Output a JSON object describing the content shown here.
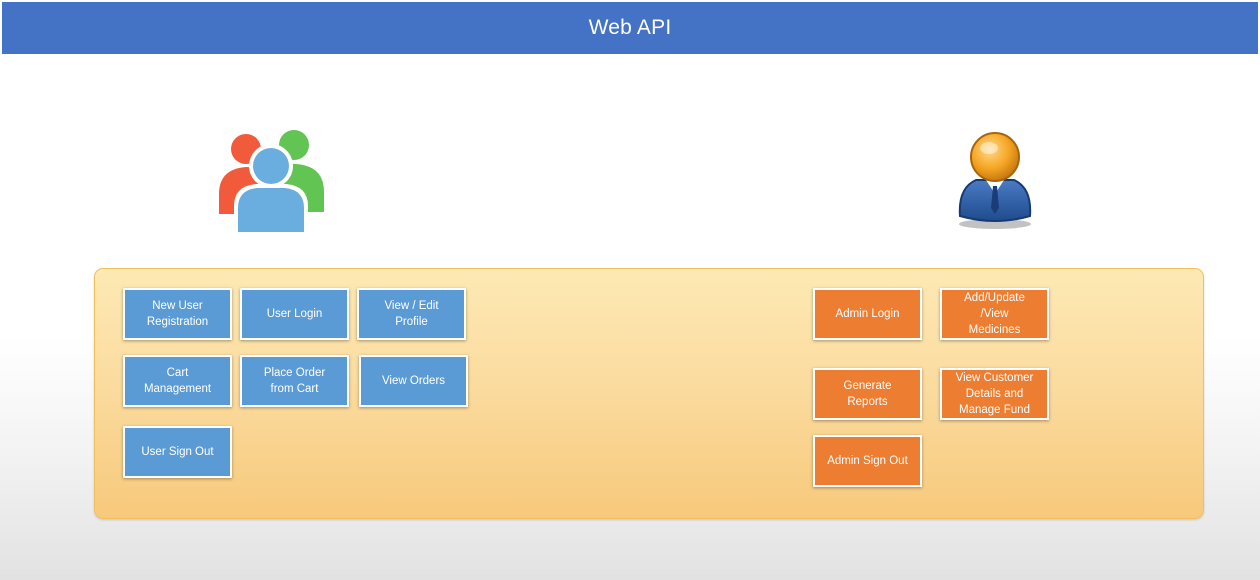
{
  "title": "Web API",
  "icons": {
    "users": "users-group-icon",
    "admin": "admin-user-icon"
  },
  "colors": {
    "header": "#4472c4",
    "user_box": "#5b9bd5",
    "admin_box": "#ed7d31",
    "panel": "#fbdca0"
  },
  "user_actions": {
    "new_user_registration": "New User\nRegistration",
    "user_login": "User Login",
    "view_edit_profile": "View / Edit\nProfile",
    "cart_management": "Cart\nManagement",
    "place_order": "Place Order\nfrom Cart",
    "view_orders": "View Orders",
    "user_sign_out": "User Sign Out"
  },
  "admin_actions": {
    "admin_login": "Admin Login",
    "manage_medicines": "Add/Update\n/View\nMedicines",
    "generate_reports": "Generate\nReports",
    "view_customer_details": "View Customer\nDetails and\nManage Fund",
    "admin_sign_out": "Admin Sign Out"
  }
}
